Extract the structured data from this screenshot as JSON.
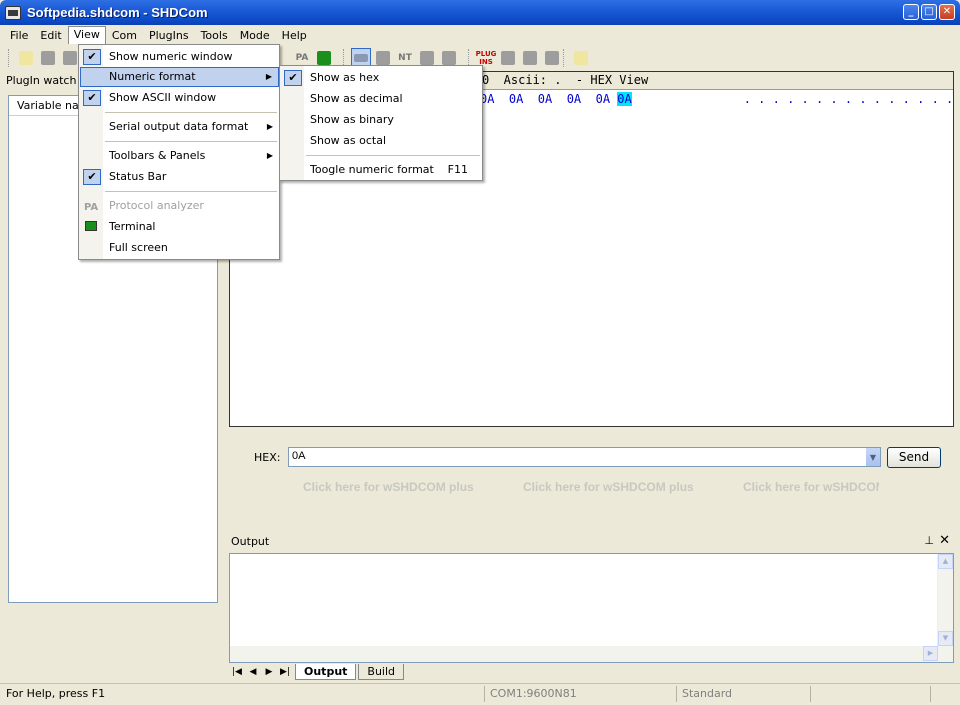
{
  "window": {
    "title": "Softpedia.shdcom - SHDCom"
  },
  "menubar": [
    "File",
    "Edit",
    "View",
    "Com",
    "PlugIns",
    "Tools",
    "Mode",
    "Help"
  ],
  "left_panel": {
    "caption": "PlugIn watch p",
    "column": "Variable nam"
  },
  "hexview": {
    "header": "0  Ascii: .  - HEX View",
    "bytes": "0A  0A  0A  0A  0A ",
    "last_byte": "0A",
    "ascii": ". . . . . . . . . . . . . . . .",
    "ascii_hl": "."
  },
  "input": {
    "label": "HEX:",
    "value": "0A",
    "send": "Send"
  },
  "ads": [
    "Click here for wSHDCOM plus",
    "Click here for wSHDCOM plus",
    "Click here for wSHDCOM plus"
  ],
  "output": {
    "title": "Output",
    "tabs": [
      "Output",
      "Build"
    ]
  },
  "status": {
    "help": "For Help, press F1",
    "port": "COM1:9600N81",
    "mode": "Standard"
  },
  "view_menu": {
    "items": [
      "Show numeric window",
      "Numeric format",
      "Show ASCII window",
      "Serial output data format",
      "Toolbars & Panels",
      "Status Bar",
      "Protocol analyzer",
      "Terminal",
      "Full screen"
    ],
    "pa_icon": "PA"
  },
  "numeric_submenu": {
    "items": [
      "Show as hex",
      "Show as decimal",
      "Show as binary",
      "Show as octal",
      "Toogle numeric format"
    ],
    "accel": "F11"
  },
  "toolbar": {
    "pa": "PA",
    "nt": "NT",
    "plug": "PLUG INS"
  }
}
